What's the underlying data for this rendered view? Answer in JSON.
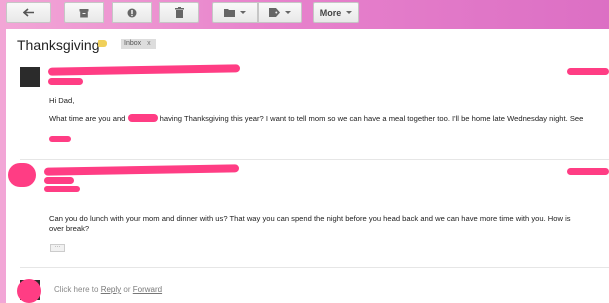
{
  "toolbar": {
    "more_label": "More"
  },
  "thread": {
    "subject": "Thanksgiving",
    "label": "Inbox",
    "label_close": "x"
  },
  "messages": [
    {
      "greeting": "Hi Dad,",
      "text_before": "What time are you and",
      "text_after": "having Thanksgiving this year? I want to tell mom so we can have a meal together too. I'll be home late Wednesday night. See"
    },
    {
      "text": "Can you do lunch with your mom and dinner with us? That way you can spend the night before you head back and we can have more time with you. How is",
      "text_line2": "over break?"
    }
  ],
  "reply": {
    "prefix": "Click here to",
    "reply_link": "Reply",
    "middle": "or",
    "forward_link": "Forward"
  },
  "colors": {
    "redaction": "#ff3d84",
    "background_pink": "#e782cc",
    "label_yellow": "#f0d05a"
  }
}
